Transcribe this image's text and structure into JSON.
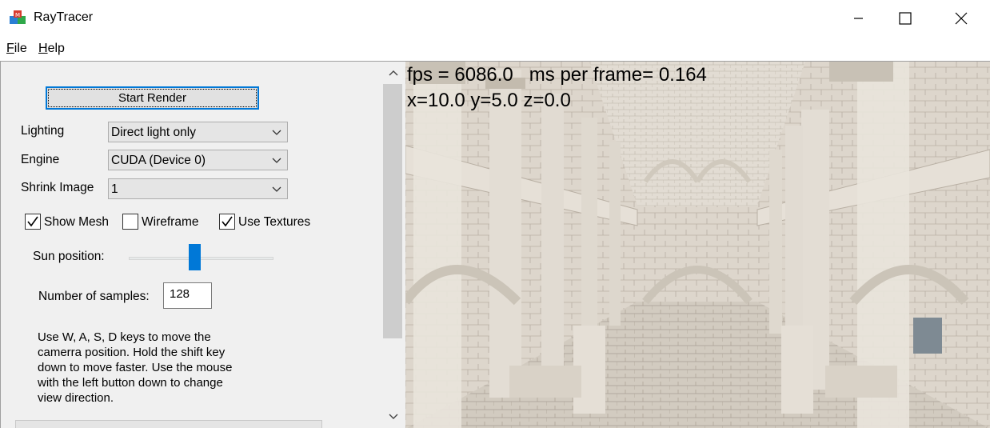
{
  "window": {
    "title": "RayTracer",
    "controls": {
      "minimize": "minimize-icon",
      "maximize": "maximize-icon",
      "close": "close-icon"
    }
  },
  "menu": {
    "file": {
      "mnemonic": "F",
      "rest": "ile"
    },
    "help": {
      "mnemonic": "H",
      "rest": "elp"
    }
  },
  "panel": {
    "start_button": "Start Render",
    "lighting": {
      "label": "Lighting",
      "value": "Direct light only"
    },
    "engine": {
      "label": "Engine",
      "value": "CUDA (Device 0)"
    },
    "shrink": {
      "label": "Shrink Image",
      "value": "1"
    },
    "checkboxes": [
      {
        "label": "Show Mesh",
        "checked": true
      },
      {
        "label": "Wireframe",
        "checked": false
      },
      {
        "label": "Use Textures",
        "checked": true
      }
    ],
    "sun_position": {
      "label": "Sun position:",
      "value_fraction": 0.45
    },
    "samples": {
      "label": "Number of samples:",
      "value": "128"
    },
    "help_text": "Use W, A, S, D keys to move the\ncamerra position. Hold the shift key\ndown to move faster. Use the mouse\nwith the left button down to change\nview direction."
  },
  "viewport": {
    "stats_line": "fps = 6086.0   ms per frame= 0.164",
    "position_line": "x=10.0 y=5.0 z=0.0"
  },
  "colors": {
    "accent": "#0078d7",
    "panel_bg": "#f0f0f0",
    "stone": "#d9d2c8"
  }
}
